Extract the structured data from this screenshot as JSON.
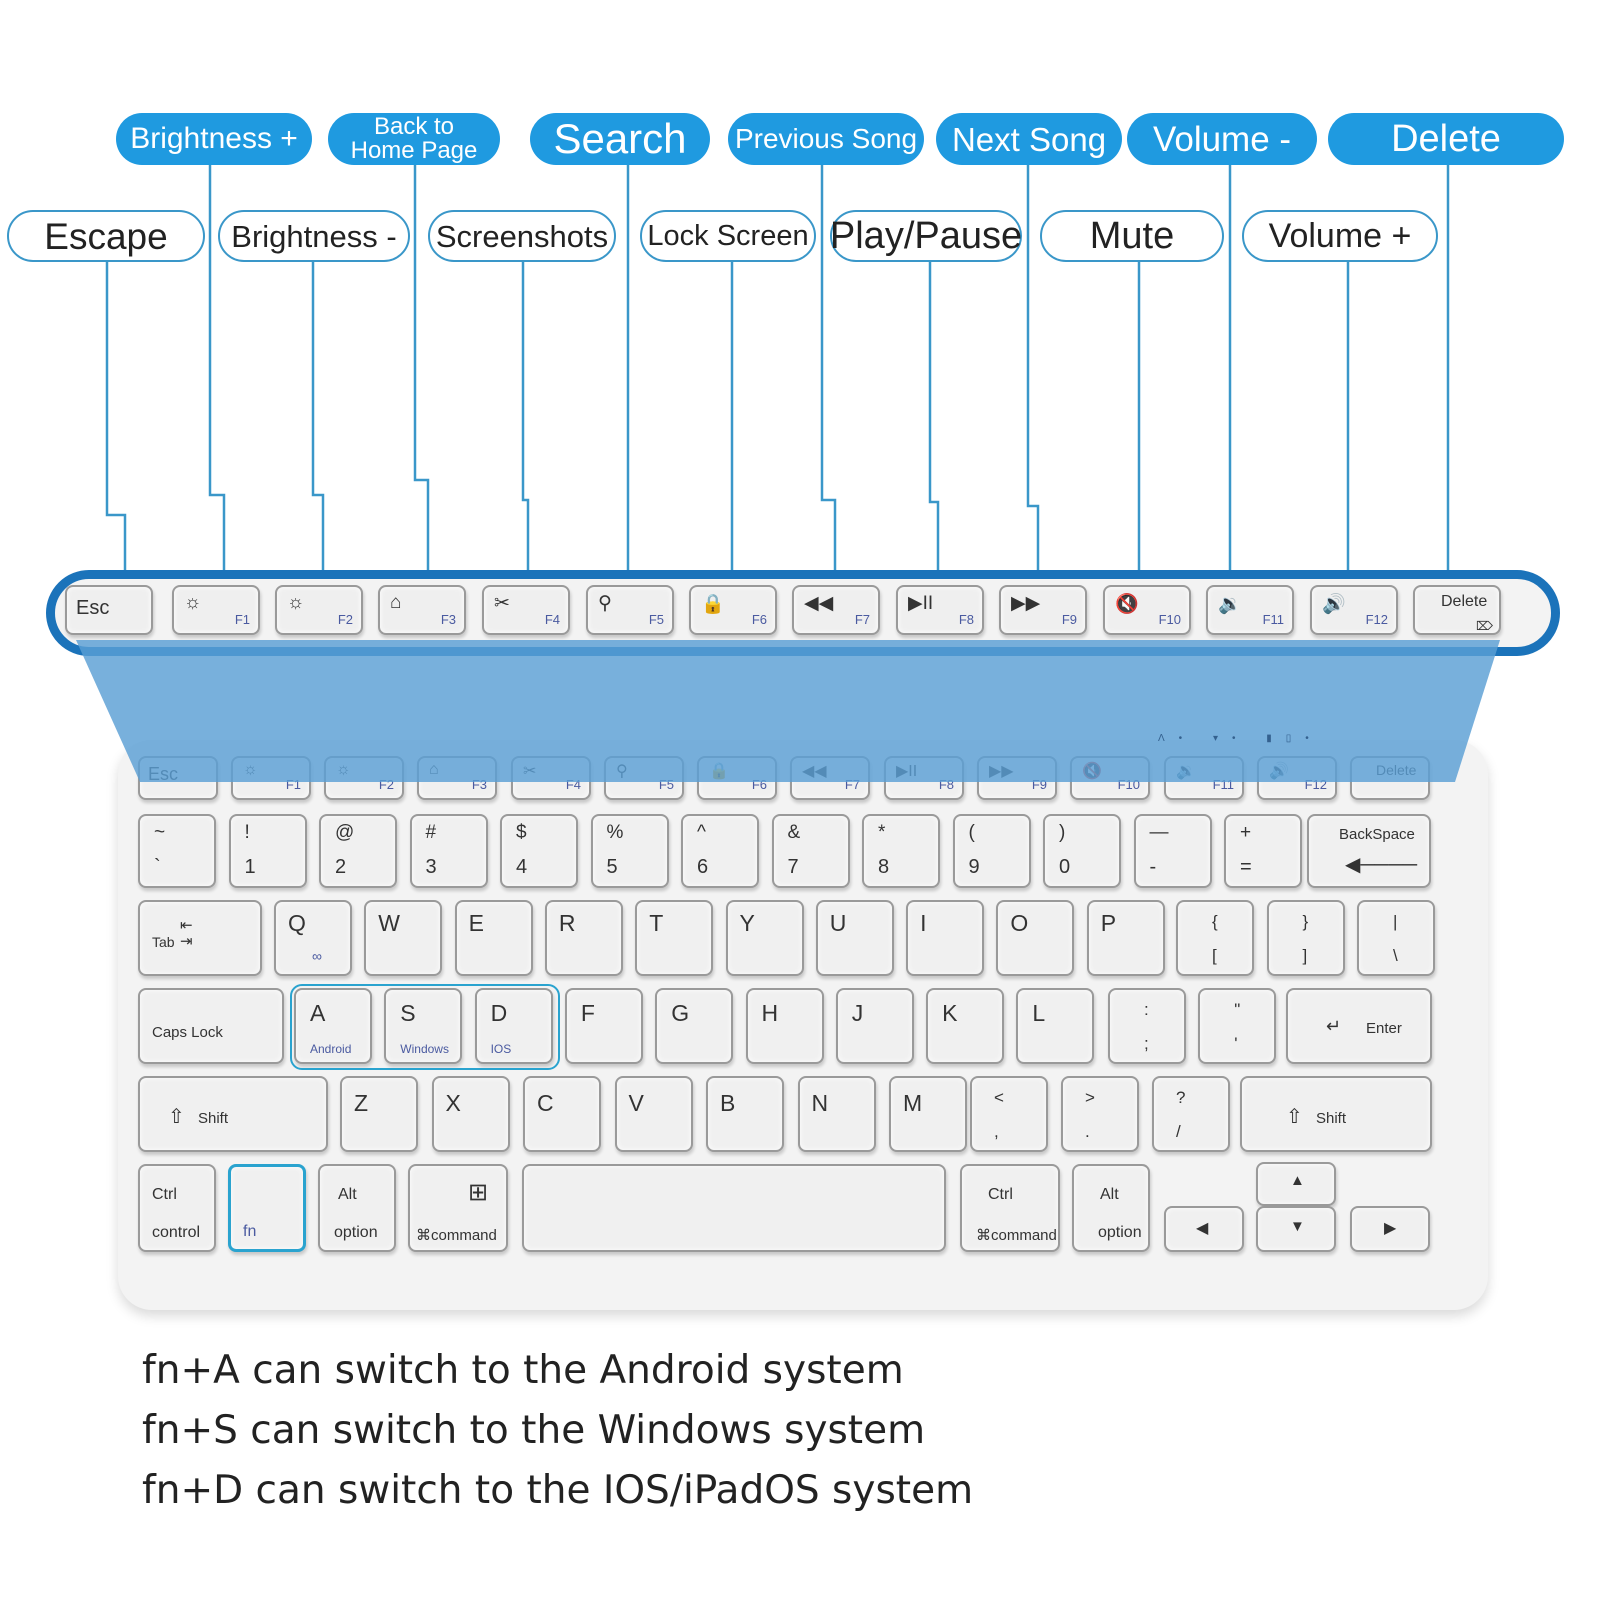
{
  "callouts_top": [
    {
      "label": "Brightness +",
      "key": "F1"
    },
    {
      "label": "Back to Home Page",
      "line1": "Back to",
      "line2": "Home Page",
      "key": "F3"
    },
    {
      "label": "Search",
      "key": "F5"
    },
    {
      "label": "Previous Song",
      "key": "F7"
    },
    {
      "label": "Next Song",
      "key": "F9"
    },
    {
      "label": "Volume -",
      "key": "F11"
    },
    {
      "label": "Delete",
      "key": "Delete"
    }
  ],
  "callouts_bottom": [
    {
      "label": "Escape",
      "key": "Esc"
    },
    {
      "label": "Brightness -",
      "key": "F2"
    },
    {
      "label": "Screenshots",
      "key": "F4"
    },
    {
      "label": "Lock Screen",
      "key": "F6"
    },
    {
      "label": "Play/Pause",
      "key": "F8"
    },
    {
      "label": "Mute",
      "key": "F10"
    },
    {
      "label": "Volume +",
      "key": "F12"
    }
  ],
  "colors": {
    "accent": "#1f9ae0",
    "bar_border": "#1b73ba",
    "line": "#3a97c9",
    "overlay": "#5a9fd4",
    "highlight": "#2aa3cf"
  },
  "fn_row": [
    {
      "label": "Esc",
      "fn": "",
      "icon": "escape"
    },
    {
      "label": "",
      "fn": "F1",
      "icon": "brightness-up-icon",
      "glyph": "☼"
    },
    {
      "label": "",
      "fn": "F2",
      "icon": "brightness-down-icon",
      "glyph": "☼"
    },
    {
      "label": "",
      "fn": "F3",
      "icon": "home-icon",
      "glyph": "⌂"
    },
    {
      "label": "",
      "fn": "F4",
      "icon": "screenshot-icon",
      "glyph": "✂"
    },
    {
      "label": "",
      "fn": "F5",
      "icon": "search-icon",
      "glyph": "⚲"
    },
    {
      "label": "",
      "fn": "F6",
      "icon": "lock-icon",
      "glyph": "🔒"
    },
    {
      "label": "",
      "fn": "F7",
      "icon": "previous-track-icon",
      "glyph": "◀◀"
    },
    {
      "label": "",
      "fn": "F8",
      "icon": "play-pause-icon",
      "glyph": "▶II"
    },
    {
      "label": "",
      "fn": "F9",
      "icon": "next-track-icon",
      "glyph": "▶▶"
    },
    {
      "label": "",
      "fn": "F10",
      "icon": "mute-icon",
      "glyph": "🔇"
    },
    {
      "label": "",
      "fn": "F11",
      "icon": "volume-down-icon",
      "glyph": "🔉"
    },
    {
      "label": "",
      "fn": "F12",
      "icon": "volume-up-icon",
      "glyph": "🔊"
    },
    {
      "label": "Delete",
      "fn": "",
      "icon": "delete-icon",
      "glyph": "⌦"
    }
  ],
  "keyboard": {
    "number_row": [
      {
        "top": "~",
        "bottom": "`"
      },
      {
        "top": "!",
        "bottom": "1"
      },
      {
        "top": "@",
        "bottom": "2"
      },
      {
        "top": "#",
        "bottom": "3"
      },
      {
        "top": "$",
        "bottom": "4"
      },
      {
        "top": "%",
        "bottom": "5"
      },
      {
        "top": "^",
        "bottom": "6"
      },
      {
        "top": "&",
        "bottom": "7"
      },
      {
        "top": "*",
        "bottom": "8"
      },
      {
        "top": "(",
        "bottom": "9"
      },
      {
        "top": ")",
        "bottom": "0"
      },
      {
        "top": "—",
        "bottom": "-"
      },
      {
        "top": "+",
        "bottom": "="
      }
    ],
    "backspace": "BackSpace",
    "tab": "Tab",
    "qwerty_row": [
      "Q",
      "W",
      "E",
      "R",
      "T",
      "Y",
      "U",
      "I",
      "O",
      "P"
    ],
    "q_sub": "pairing-link",
    "brackets": [
      {
        "top": "{",
        "bottom": "["
      },
      {
        "top": "}",
        "bottom": "]"
      },
      {
        "top": "|",
        "bottom": "\\"
      }
    ],
    "caps": "Caps Lock",
    "home_row": [
      "A",
      "S",
      "D",
      "F",
      "G",
      "H",
      "J",
      "K",
      "L"
    ],
    "home_sub": {
      "A": "Android",
      "S": "Windows",
      "D": "IOS"
    },
    "home_punct": [
      {
        "top": ":",
        "bottom": ";"
      },
      {
        "top": "\"",
        "bottom": "'"
      }
    ],
    "enter": "Enter",
    "shift": "Shift",
    "bottom_row": [
      "Z",
      "X",
      "C",
      "V",
      "B",
      "N",
      "M"
    ],
    "bottom_punct": [
      {
        "top": "<",
        "bottom": ","
      },
      {
        "top": ">",
        "bottom": "."
      },
      {
        "top": "?",
        "bottom": "/"
      }
    ],
    "ctrl": "Ctrl",
    "control": "control",
    "fn": "fn",
    "alt": "Alt",
    "option": "option",
    "command": "⌘command",
    "indicators": [
      "A",
      "wifi",
      "battery"
    ]
  },
  "notes": [
    "fn+A can switch to the Android system",
    "fn+S can switch to the Windows system",
    "fn+D can switch to the IOS/iPadOS system"
  ]
}
